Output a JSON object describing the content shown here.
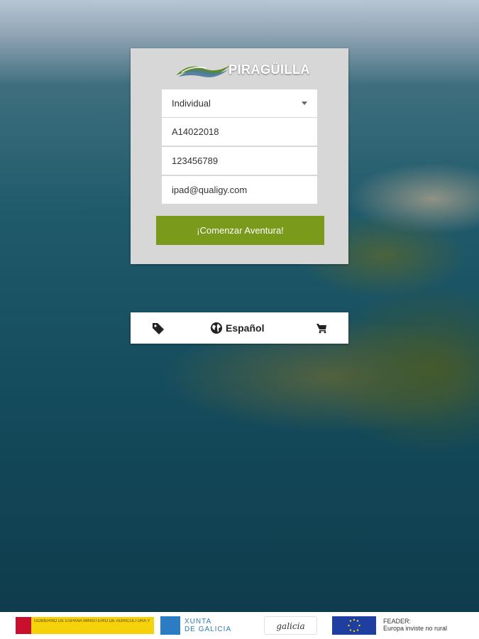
{
  "app": {
    "logo_text": "PIRAGÜILLA"
  },
  "form": {
    "type_select": "Individual",
    "code_value": "A14022018",
    "number_value": "123456789",
    "email_value": "ipad@qualigy.com",
    "start_button": "¡Comenzar Aventura!"
  },
  "bar": {
    "language": "Español",
    "tag_icon": "tag-icon",
    "globe_icon": "globe-icon",
    "cart_icon": "cart-icon"
  },
  "footer": {
    "spain_text": "GOBIERNO DE ESPAÑA  MINISTERIO DE AGRICULTURA Y PESCA, ALIMENTACIÓN Y MEDIO AMBIENTE",
    "xunta_line1": "XUNTA",
    "xunta_line2": "DE GALICIA",
    "galicia": "galicia",
    "feader_line1": "FEADER:",
    "feader_line2": "Europa inviste no rural"
  },
  "colors": {
    "accent": "#7a9a1c",
    "card_bg": "#d7d7d7"
  }
}
